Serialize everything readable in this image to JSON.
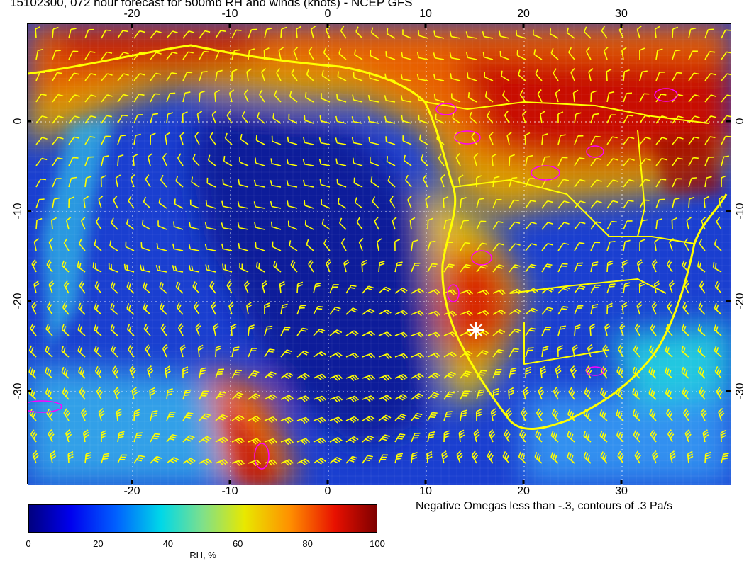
{
  "title": "15102300, 072 hour forecast for 500mb RH and winds (knots) - NCEP GFS",
  "longitude_ticks": [
    "-20",
    "-10",
    "0",
    "10",
    "20",
    "30"
  ],
  "latitude_ticks": [
    "0",
    "-10",
    "-20",
    "-30"
  ],
  "omega_note": "Negative Omegas less than -.3, contours of .3 Pa/s",
  "colorbar": {
    "title": "RH, %",
    "ticks": [
      "0",
      "20",
      "40",
      "60",
      "80",
      "100"
    ],
    "min": 0,
    "max": 100,
    "stops": [
      {
        "value": 0,
        "color": "#00007f"
      },
      {
        "value": 12,
        "color": "#0000ee"
      },
      {
        "value": 25,
        "color": "#0060ff"
      },
      {
        "value": 38,
        "color": "#00d8e8"
      },
      {
        "value": 50,
        "color": "#7fe08a"
      },
      {
        "value": 62,
        "color": "#e8e800"
      },
      {
        "value": 75,
        "color": "#ff9000"
      },
      {
        "value": 88,
        "color": "#e81000"
      },
      {
        "value": 100,
        "color": "#7f0000"
      }
    ]
  },
  "colors": {
    "coastline": "#ffff00",
    "wind_barbs": "#ffff00",
    "omega_contours": "#ff00ff",
    "marker": "#ffffff"
  }
}
